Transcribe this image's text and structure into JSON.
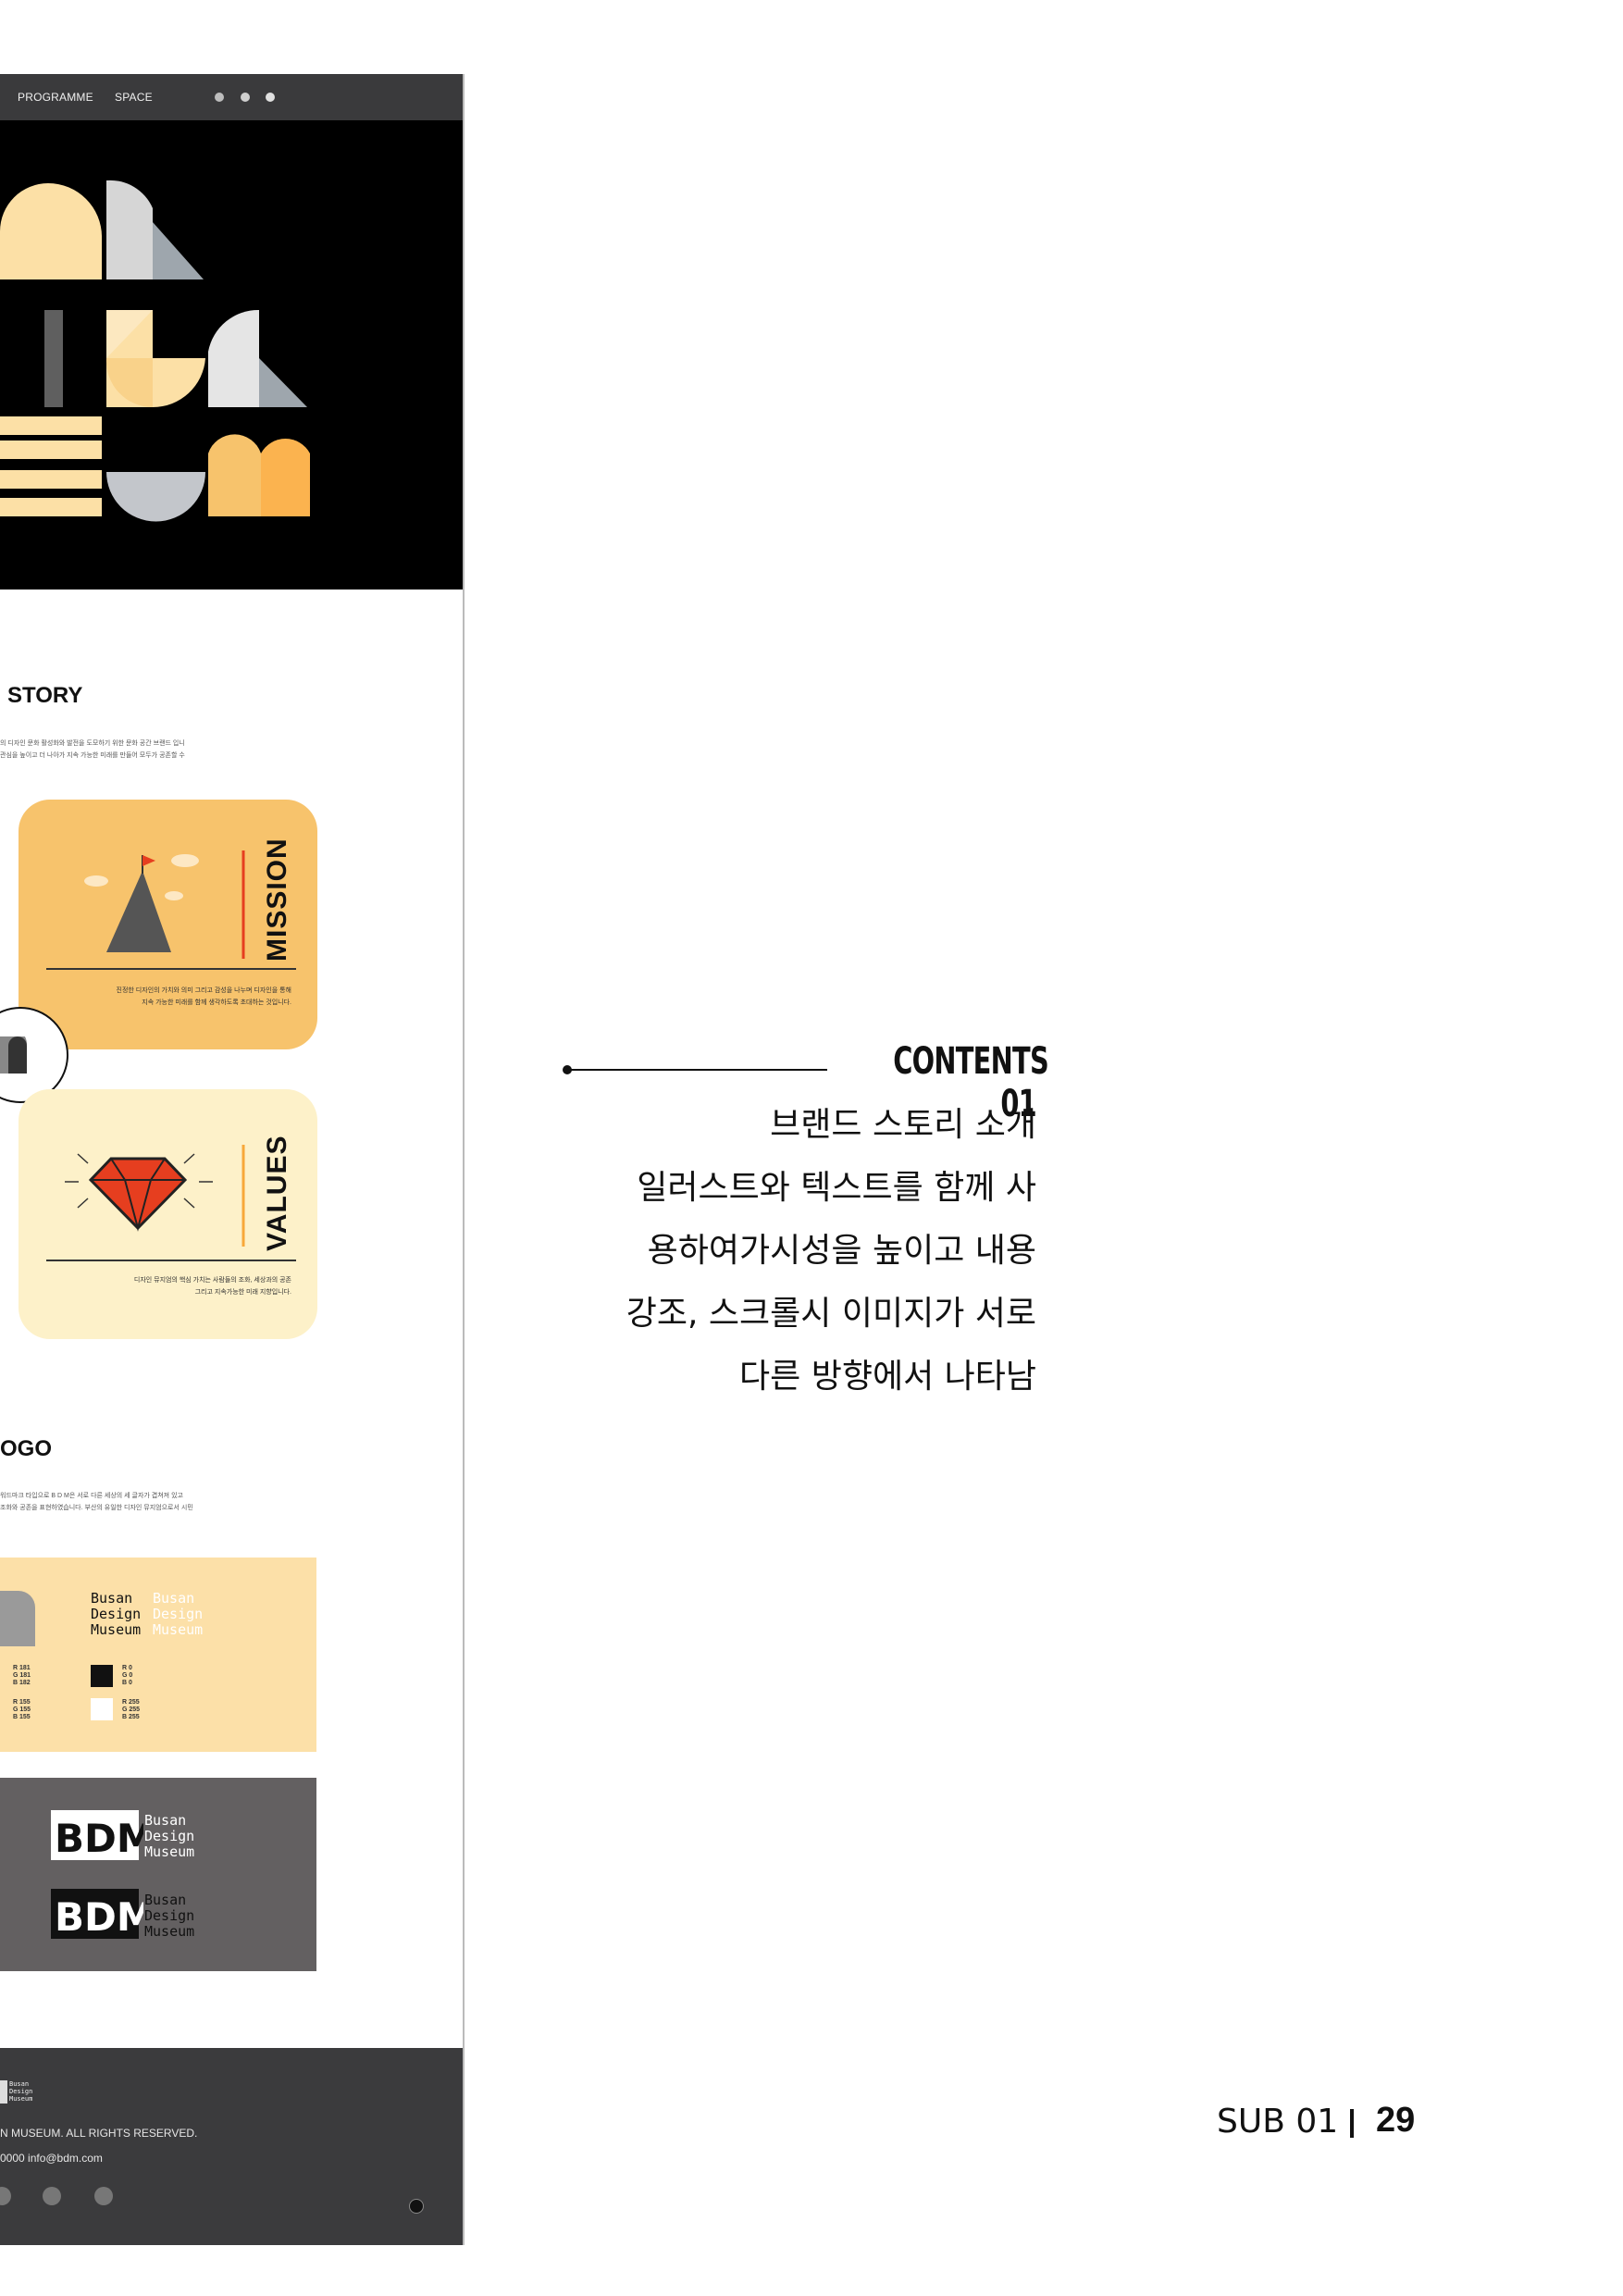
{
  "nav": {
    "items": [
      "PROGRAMME",
      "SPACE"
    ],
    "icons": [
      "globe-icon",
      "circle-icon",
      "user-icon"
    ]
  },
  "story": {
    "title": "STORY",
    "desc_lines": [
      "의 디자인 문화 활성화와 발전을 도모하기 위한 문화 공간 브랜드 입니",
      "관심을 높이고 더 나아가 지속 가능한 미래를 만들어 모두가 공존할 수"
    ]
  },
  "mission": {
    "label": "MISSION",
    "text_lines": [
      "진정한 디자인의 가치와 의미 그리고 감성을 나누며 디자인을 통해",
      "지속 가능한 미래를 함께 생각하도록 초대하는 것입니다."
    ]
  },
  "values": {
    "label": "VALUES",
    "text_lines": [
      "디자인 뮤지엄의 핵심 가치는 사람들의 조화, 세상과의 공존",
      "그리고 지속가능한 미래 지향입니다."
    ]
  },
  "logo": {
    "title": "OGO",
    "desc_lines": [
      "워드마크 타입으로 B D M은 서로 다른 세상의 세 글자가 겹쳐져 있고",
      "조화와 공존을 표현하였습니다. 부산의 유일한 디자인 뮤지엄으로서 시민"
    ],
    "wordmark": [
      "Busan",
      "Design",
      "Museum"
    ],
    "rgb_gray1": [
      "R 181",
      "G 181",
      "B 182"
    ],
    "rgb_gray2": [
      "R 155",
      "G 155",
      "B 155"
    ],
    "rgb_black": [
      "R 0",
      "G 0",
      "B 0"
    ],
    "rgb_white": [
      "R 255",
      "G 255",
      "B 255"
    ]
  },
  "footer": {
    "copyright": "N MUSEUM. ALL RIGHTS RESERVED.",
    "contact": "0000   info@bdm.com",
    "logo_words": [
      "Busan",
      "Design",
      "Museum"
    ]
  },
  "contents": {
    "title": "CONTENTS 01",
    "lines": [
      "브랜드 스토리 소개",
      "일러스트와 텍스트를 함께 사",
      "용하여가시성을 높이고 내용",
      "강조, 스크롤시 이미지가 서로",
      "다른 방향에서 나타남"
    ]
  },
  "page": {
    "sub": "SUB 01",
    "number": "29"
  },
  "colors": {
    "nav_bg": "#3a3a3c",
    "cream": "#fce0a6",
    "orange": "#f7c36c",
    "card_mission": "#f7c36c",
    "card_values": "#fdf1c9",
    "logo_panel_light": "#fce0a8",
    "logo_panel_dark": "#636061",
    "accent_red": "#e63e1f",
    "footer_bg": "#3b3b3d"
  }
}
